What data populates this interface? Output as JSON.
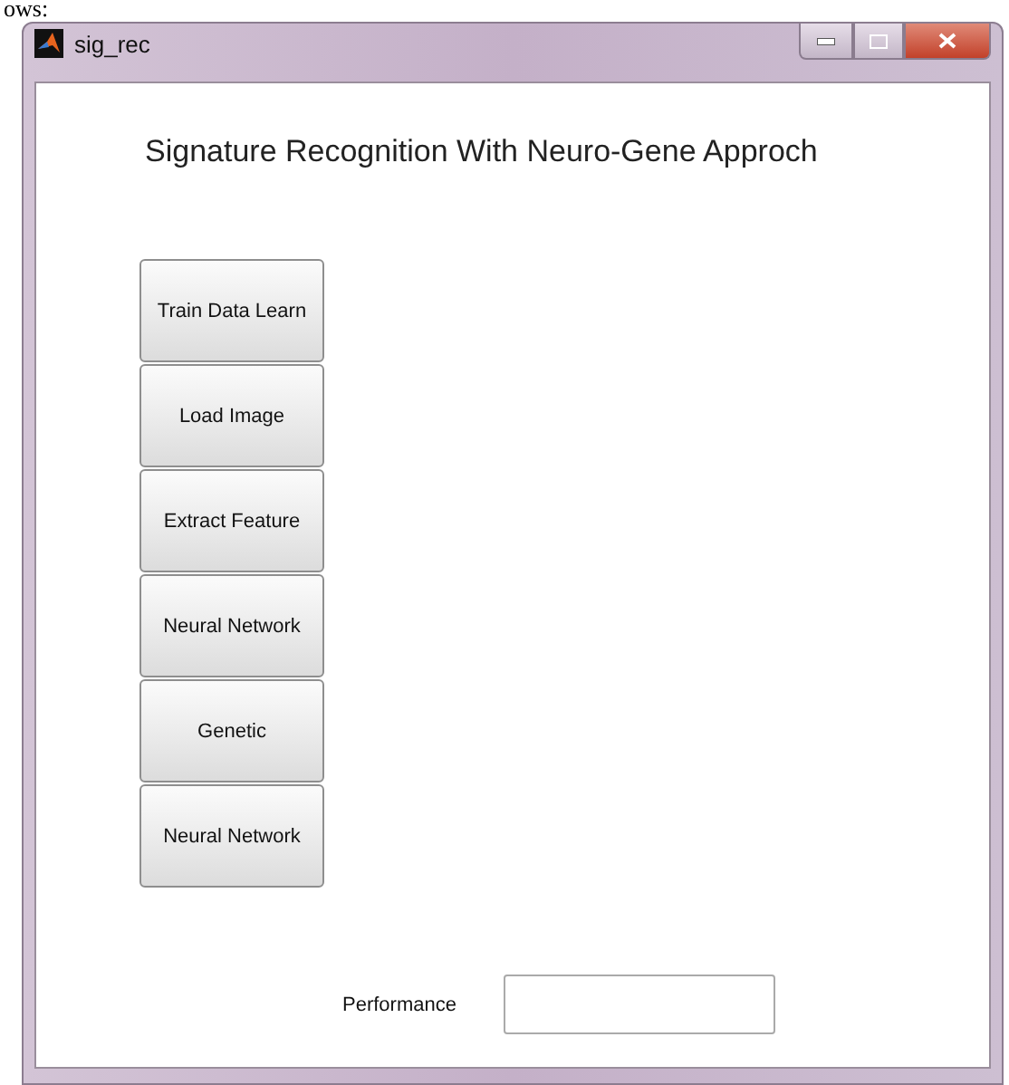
{
  "document_fragment": "ows:",
  "window": {
    "title": "sig_rec"
  },
  "heading": "Signature Recognition With Neuro-Gene Approch",
  "buttons": [
    {
      "label": "Train Data Learn"
    },
    {
      "label": "Load Image"
    },
    {
      "label": "Extract Feature"
    },
    {
      "label": "Neural Network"
    },
    {
      "label": "Genetic"
    },
    {
      "label": "Neural Network"
    }
  ],
  "performance": {
    "label": "Performance"
  }
}
